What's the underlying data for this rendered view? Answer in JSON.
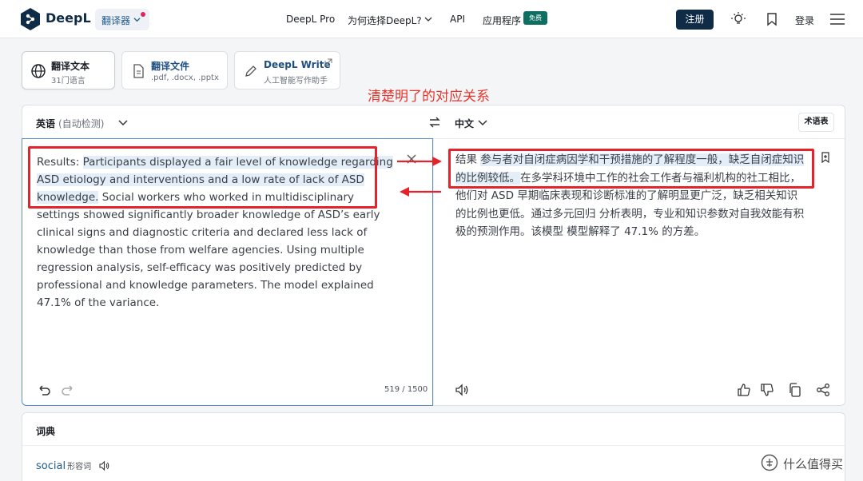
{
  "header": {
    "logo_text": "DeepL",
    "translator_label": "翻译器",
    "nav": [
      "DeepL Pro",
      "为何选择DeepL?",
      "API",
      "应用程序"
    ],
    "free_badge": "免费",
    "register_label": "注册",
    "login_label": "登录",
    "icons": [
      "lightbulb-icon",
      "bookmark-icon",
      "menu-icon"
    ]
  },
  "modes": [
    {
      "title": "翻译文本",
      "sub": "31门语言"
    },
    {
      "title": "翻译文件",
      "sub": ".pdf, .docx, .pptx"
    },
    {
      "title": "DeepL Write",
      "sub": "人工智能写作助手"
    }
  ],
  "annotation": {
    "title": "清楚明了的对应关系"
  },
  "translator": {
    "source_lang": "英语",
    "source_auto": "(自动检测)",
    "target_lang": "中文",
    "glossary_label": "术语表",
    "source_text_prefix": "Results: ",
    "source_text_highlight": "Participants displayed a fair level of knowledge regarding ASD etiology and interventions and a low rate of lack of ASD knowledge.",
    "source_text_rest": " Social workers who worked in multidisciplinary settings showed significantly broader knowledge of ASD’s early clinical signs and diagnostic criteria and declared less lack of knowledge than those from welfare agencies. Using multiple regression analysis, self-efficacy was positively predicted by professional and knowledge parameters. The model explained 47.1% of the variance.",
    "char_count": "519 / 1500",
    "target_text_prefix": "结果 ",
    "target_text_highlight": "参与者对自闭症病因学和干预措施的了解程度一般，缺乏自闭症知识的比例较低。",
    "target_text_rest": "在多学科环境中工作的社会工作者与福利机构的社工相比，他们对 ASD 早期临床表现和诊断标准的了解明显更广泛，缺乏相关知识的比例也更低。通过多元回归 分析表明，专业和知识参数对自我效能有积极的预测作用。该模型 模型解释了 47.1% 的方差。"
  },
  "dictionary": {
    "title": "词典",
    "word": "social",
    "pos": "形容词"
  },
  "watermark": {
    "text": "什么值得买"
  },
  "colors": {
    "accent": "#0f2b46",
    "annotation_red": "#e4232a",
    "highlight": "#e3eef8"
  }
}
